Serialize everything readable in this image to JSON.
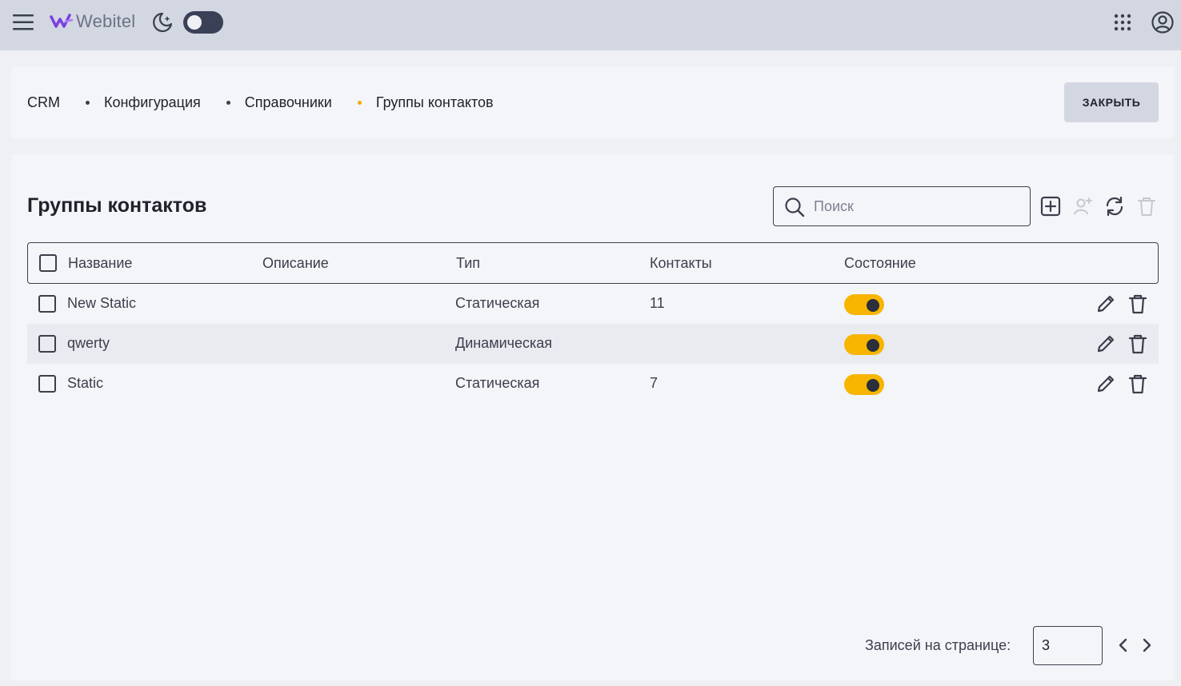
{
  "header": {
    "logo_text": "Webitel",
    "icons": [
      "menu-icon",
      "theme-moon-icon",
      "apps-grid-icon",
      "user-account-icon"
    ],
    "theme_toggle_on": false
  },
  "breadcrumb": [
    "CRM",
    "Конфигурация",
    "Справочники",
    "Группы контактов"
  ],
  "close_button": "ЗАКРЫТЬ",
  "page": {
    "title": "Группы контактов",
    "search_placeholder": "Поиск"
  },
  "table": {
    "columns": [
      "Название",
      "Описание",
      "Тип",
      "Контакты",
      "Состояние"
    ],
    "rows": [
      {
        "name": "New Static",
        "description": "",
        "type": "Статическая",
        "contacts": "11",
        "state": true
      },
      {
        "name": "qwerty",
        "description": "",
        "type": "Динамическая",
        "contacts": "",
        "state": true
      },
      {
        "name": "Static",
        "description": "",
        "type": "Статическая",
        "contacts": "7",
        "state": true
      }
    ]
  },
  "pagination": {
    "label": "Записей на странице:",
    "per_page": "3"
  },
  "colors": {
    "topbar_bg": "#d3d7e1",
    "accent_toggle": "#f7b500",
    "active_crumb_dot": "#f2a900",
    "logo_purple": "#7b3fe4"
  }
}
